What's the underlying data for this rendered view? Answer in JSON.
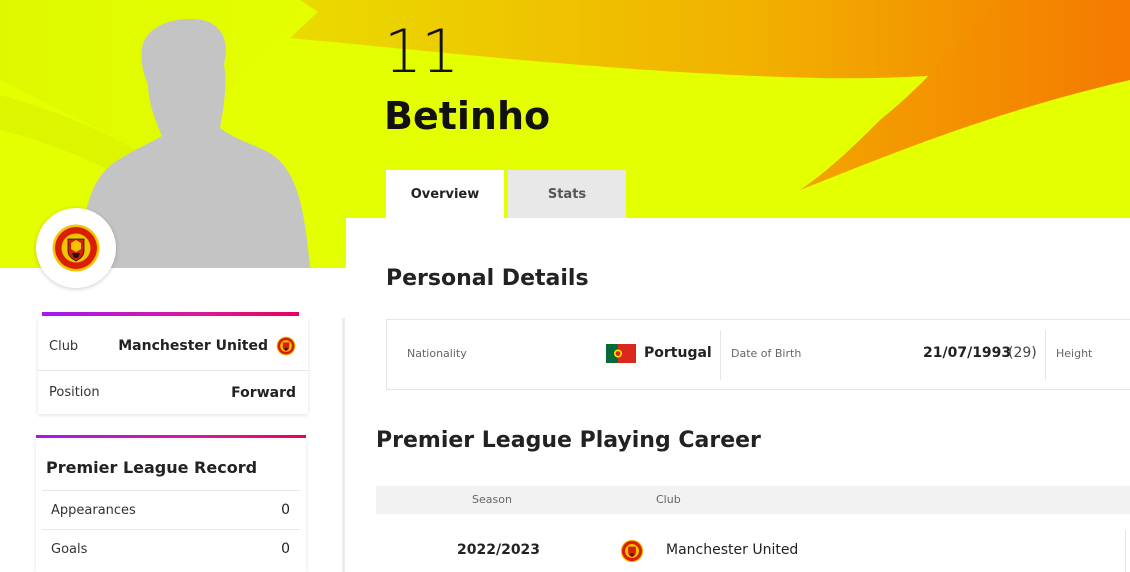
{
  "player": {
    "shirt_number": "11",
    "name": "Betinho"
  },
  "tabs": [
    {
      "label": "Overview",
      "active": true
    },
    {
      "label": "Stats",
      "active": false
    }
  ],
  "club_card": {
    "club_label": "Club",
    "club_value": "Manchester United",
    "position_label": "Position",
    "position_value": "Forward"
  },
  "record": {
    "title": "Premier League Record",
    "rows": [
      {
        "label": "Appearances",
        "value": "0"
      },
      {
        "label": "Goals",
        "value": "0"
      }
    ]
  },
  "personal_details": {
    "title": "Personal Details",
    "nationality_label": "Nationality",
    "nationality_value": "Portugal",
    "dob_label": "Date of Birth",
    "dob_value": "21/07/1993",
    "age": "(29)",
    "height_label": "Height"
  },
  "career": {
    "title": "Premier League Playing Career",
    "headers": {
      "season": "Season",
      "club": "Club"
    },
    "rows": [
      {
        "season": "2022/2023",
        "club": "Manchester United"
      }
    ]
  },
  "colors": {
    "hero_yellow": "#e4ff00",
    "hero_orange": "#f47a00",
    "accent_purple": "#a517f0",
    "accent_pink": "#e9005e",
    "crest_red": "#d81e05",
    "crest_gold": "#f5c400"
  },
  "icons": {
    "crest": "club-crest-icon",
    "flag": "portugal-flag-icon",
    "silhouette": "player-silhouette-icon"
  }
}
